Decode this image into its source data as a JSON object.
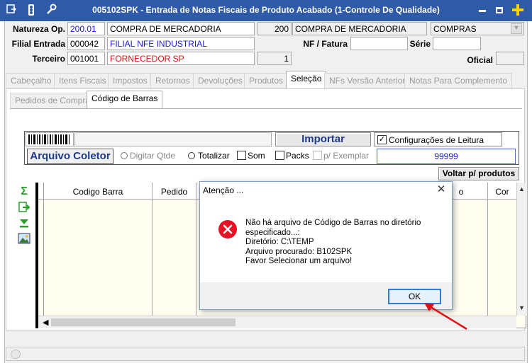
{
  "window": {
    "title": "005102SPK - Entrada de Notas Fiscais de Produto Acabado (1-Controle De Qualidade)"
  },
  "header": {
    "natureza_label": "Natureza Op.",
    "natureza_code": "200.01",
    "natureza_desc": "COMPRA DE MERCADORIA",
    "natureza_code2": "200",
    "natureza_desc2": "COMPRA DE MERCADORIA",
    "tipo_select": "COMPRAS",
    "filial_label": "Filial Entrada",
    "filial_code": "000042",
    "filial_desc": "FILIAL NFE INDUSTRIAL",
    "nf_label": "NF / Fatura",
    "nf_value": "",
    "serie_label": "Série",
    "serie_value": "",
    "terceiro_label": "Terceiro",
    "terceiro_code": "001001",
    "terceiro_desc": "FORNECEDOR SP",
    "terceiro_num": "1",
    "oficial_label": "Oficial",
    "oficial_value": ""
  },
  "tabs": [
    "Cabeçalho",
    "Itens Fiscais",
    "Impostos",
    "Retornos",
    "Devoluções",
    "Produtos",
    "Seleção",
    "NFs Versão Anterior",
    "Notas Para Complemento"
  ],
  "subtabs": [
    "Pedidos de Compra",
    "Código de Barras"
  ],
  "barcode": {
    "importar_label": "Importar",
    "config_label": "Configurações de Leitura",
    "arquivo_label": "Arquivo Coletor",
    "digitar_label": "Digitar Qtde",
    "totalizar_label": "Totalizar",
    "som_label": "Som",
    "packs_label": "Packs",
    "exemplar_label": "p/ Exemplar",
    "qty_value": "99999",
    "voltar_label": "Voltar p/ produtos"
  },
  "grid": {
    "columns": [
      "Codigo Barra",
      "Pedido",
      "o",
      "Cor"
    ]
  },
  "dialog": {
    "title": "Atenção ...",
    "line1": "Não há arquivo de Código de Barras no diretório",
    "line2": "especificado...:",
    "line3": "Diretório: C:\\TEMP",
    "line4": "Arquivo procurado: B102SPK",
    "line5": "Favor Selecionar um arquivo!",
    "ok_label": "OK"
  },
  "colors": {
    "titlebar": "#2e5aa8",
    "arrow": "#e01010",
    "error": "#e81123"
  }
}
